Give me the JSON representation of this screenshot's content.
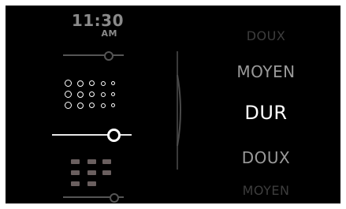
{
  "status": {
    "time": "11:30",
    "ampm": "AM"
  },
  "option_cards": [
    {
      "icon": "slider-icon",
      "state": "faded"
    },
    {
      "icon": "dot-grid-icon",
      "state": "selected"
    },
    {
      "icon": "square-grid-icon",
      "state": "faded"
    }
  ],
  "firmness_wheel": {
    "items": [
      "DOUX",
      "MOYEN",
      "DUR",
      "DOUX",
      "MOYEN"
    ],
    "selected_index": 2
  },
  "colors": {
    "background": "#000000",
    "active": "#ffffff",
    "inactive": "#555555",
    "square_fill": "#6a5f5f"
  }
}
